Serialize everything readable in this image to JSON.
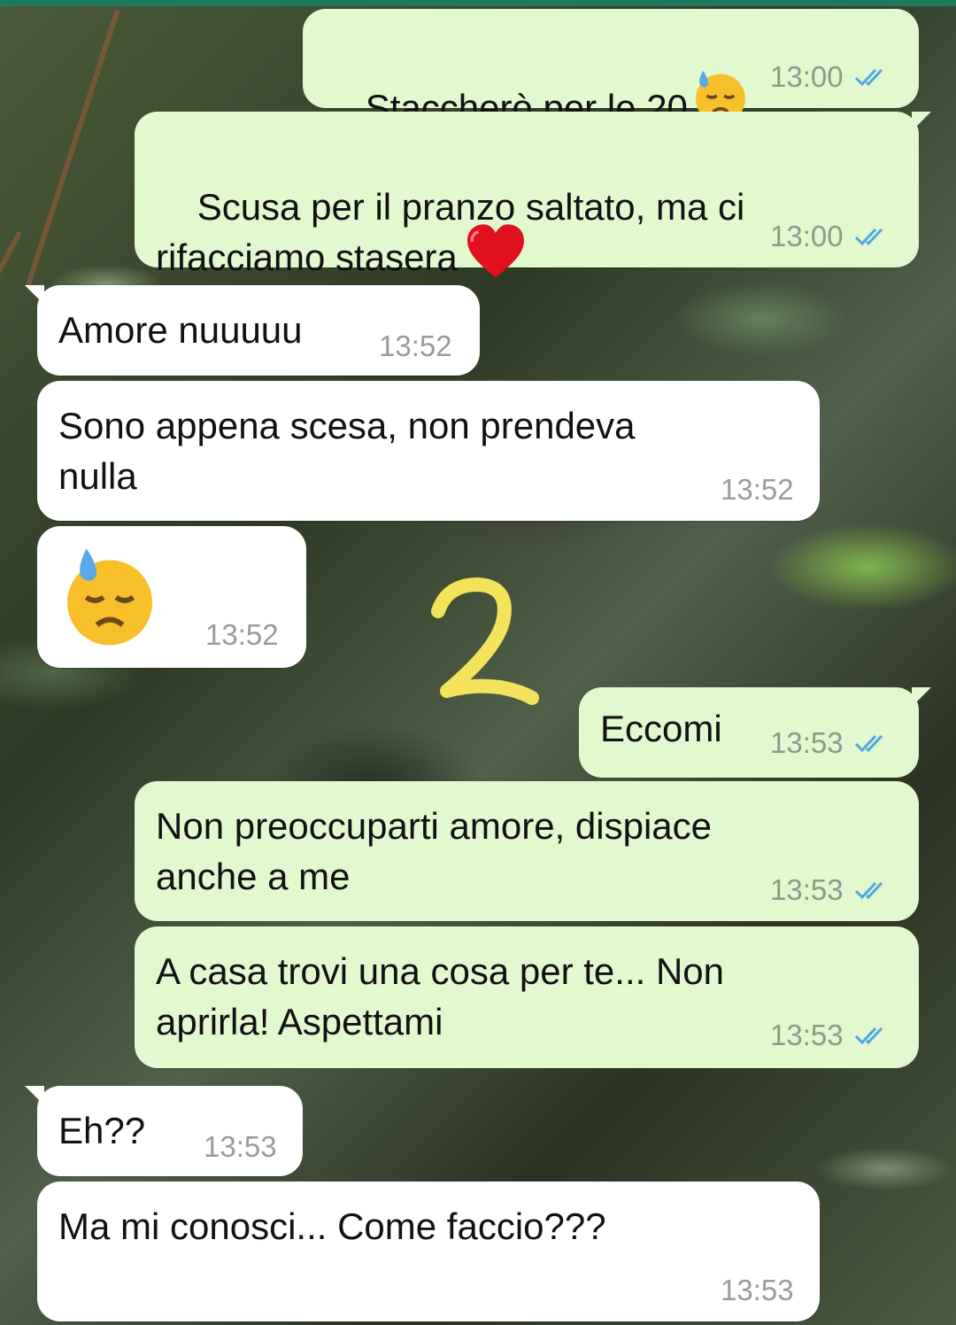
{
  "chat": {
    "messages": [
      {
        "direction": "out",
        "text": "Staccherò per le 20",
        "emoji": "downcast-sweat",
        "time": "13:00",
        "status": "read"
      },
      {
        "direction": "out",
        "text": "Scusa per il pranzo saltato, ma ci\nrifacciamo stasera",
        "emoji": "red-heart",
        "time": "13:00",
        "status": "read"
      },
      {
        "direction": "in",
        "text": "Amore nuuuuu",
        "time": "13:52"
      },
      {
        "direction": "in",
        "text": "Sono appena scesa, non prendeva\nnulla",
        "time": "13:52"
      },
      {
        "direction": "in",
        "text": "",
        "emoji": "downcast-sweat",
        "time": "13:52"
      },
      {
        "direction": "out",
        "text": "Eccomi",
        "time": "13:53",
        "status": "read"
      },
      {
        "direction": "out",
        "text": "Non preoccuparti amore, dispiace\nanche a me",
        "time": "13:53",
        "status": "read"
      },
      {
        "direction": "out",
        "text": "A casa trovi una cosa per te... Non\naprirla! Aspettami",
        "time": "13:53",
        "status": "read"
      },
      {
        "direction": "in",
        "text": "Eh??",
        "time": "13:53"
      },
      {
        "direction": "in",
        "text": "Ma mi conosci... Come faccio???",
        "time": "13:53"
      }
    ]
  },
  "overlay": {
    "number": "2",
    "color": "#f2e35a"
  },
  "colors": {
    "outgoing_bubble": "#e2f8cf",
    "incoming_bubble": "#ffffff",
    "read_ticks": "#4fa6e0",
    "header_bar": "#1f7a5b"
  }
}
